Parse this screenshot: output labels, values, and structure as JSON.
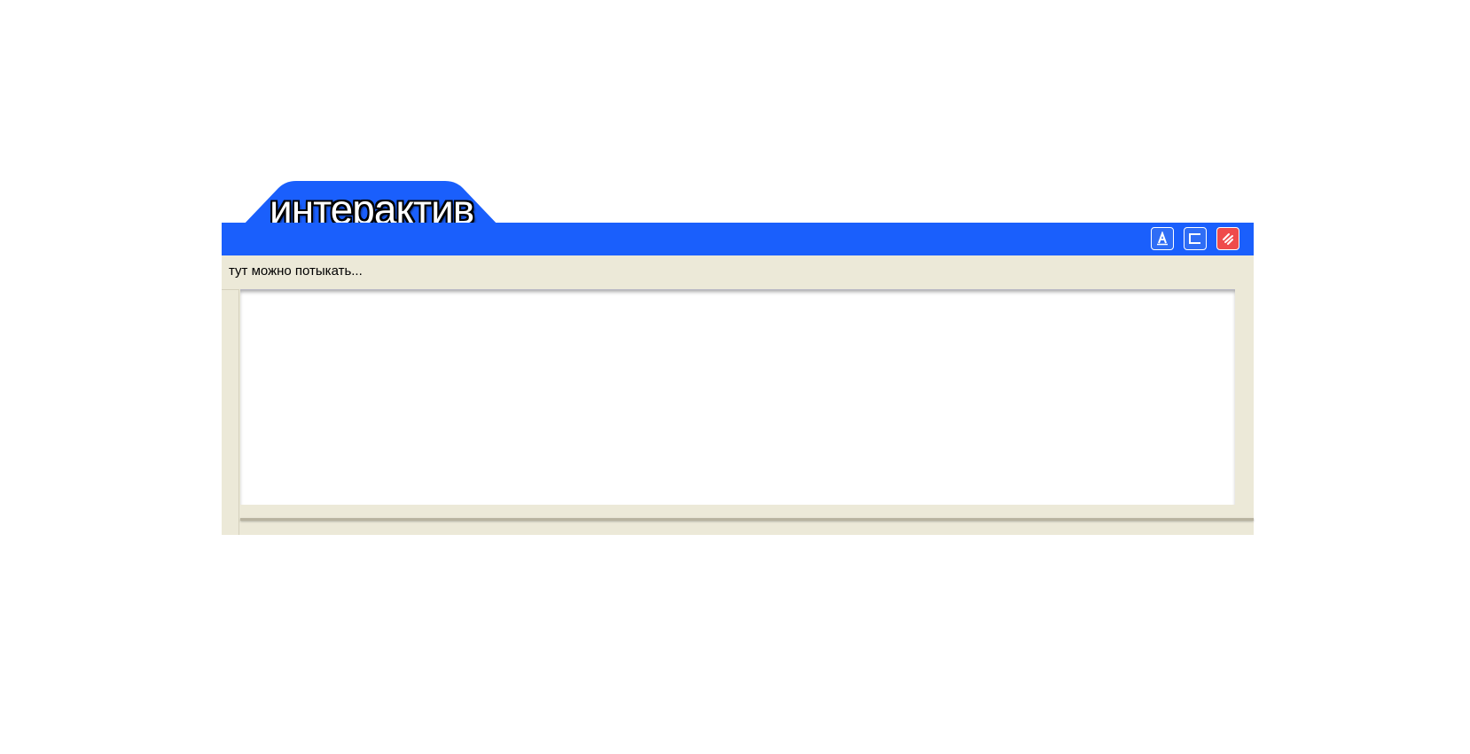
{
  "window": {
    "title": "интерактив",
    "caption": "тут можно потыкать...",
    "controls": {
      "font_button": "font-a-icon",
      "maximize_button": "window-rect-icon",
      "close_button": "close-slash-icon"
    }
  },
  "colors": {
    "title_bar": "#1a5ffc",
    "body": "#ece9d8",
    "content": "#ffffff",
    "close_button": "#ef4b4b"
  }
}
